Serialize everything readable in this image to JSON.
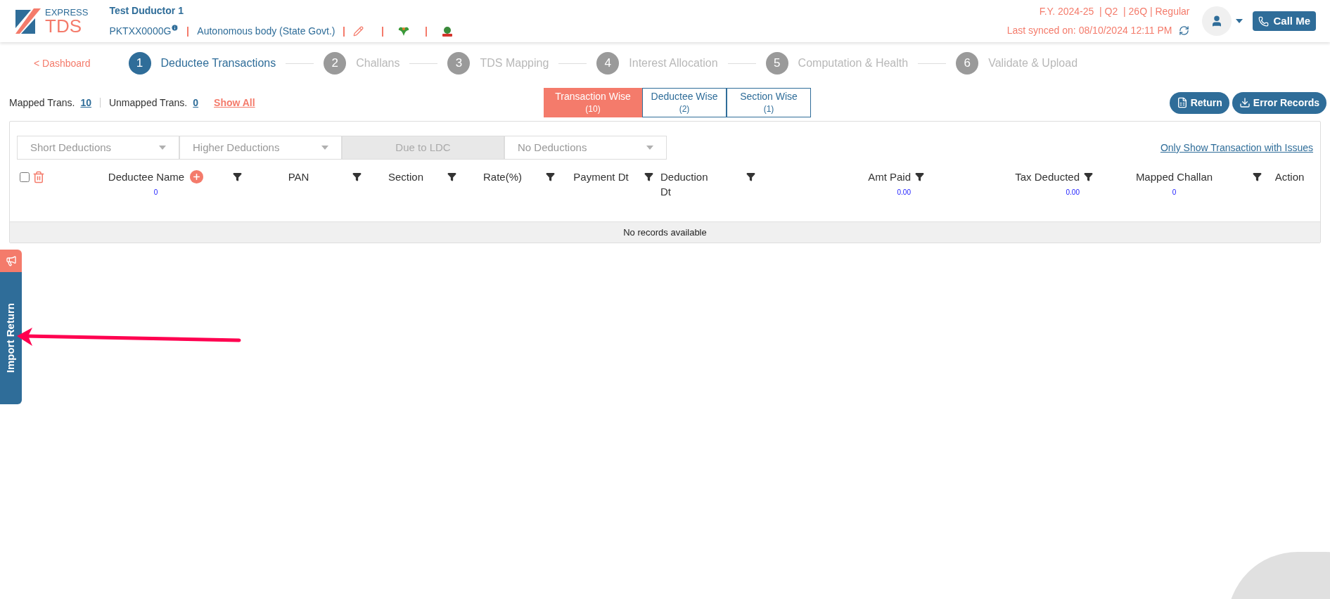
{
  "header": {
    "logo": {
      "top": "EXPRESS",
      "bottom": "TDS"
    },
    "deductor_name": "Test Duductor 1",
    "pan": "PKTXX0000G",
    "deductor_type": "Autonomous body (State Govt.)",
    "return_info": "F.Y. 2024-25  | Q2  | 26Q | Regular",
    "last_synced": "Last synced on: 08/10/2024 12:11 PM",
    "call_button": "Call Me"
  },
  "back_link": "< Dashboard",
  "steps": [
    {
      "number": "1",
      "label": "Deductee Transactions",
      "selected": true
    },
    {
      "number": "2",
      "label": "Challans",
      "selected": false
    },
    {
      "number": "3",
      "label": "TDS Mapping",
      "selected": false
    },
    {
      "number": "4",
      "label": "Interest Allocation",
      "selected": false
    },
    {
      "number": "5",
      "label": "Computation & Health",
      "selected": false
    },
    {
      "number": "6",
      "label": "Validate & Upload",
      "selected": false
    }
  ],
  "summary": {
    "mapped_label": "Mapped Trans.",
    "mapped_count": "10",
    "unmapped_label": "Unmapped Trans.",
    "unmapped_count": "0",
    "show_all": "Show All"
  },
  "view_tabs": [
    {
      "label": "Transaction Wise",
      "count": "(10)",
      "selected": true
    },
    {
      "label": "Deductee Wise",
      "count": "(2)",
      "selected": false
    },
    {
      "label": "Section Wise",
      "count": "(1)",
      "selected": false
    }
  ],
  "actions": [
    "Return",
    "Error Records"
  ],
  "filters": [
    {
      "label": "Short Deductions",
      "disabled": false
    },
    {
      "label": "Higher Deductions",
      "disabled": false
    },
    {
      "label": "Due to LDC",
      "disabled": true
    },
    {
      "label": "No Deductions",
      "disabled": false
    }
  ],
  "issues_link": "Only Show Transaction with Issues",
  "table": {
    "select_all": {
      "checked": false
    },
    "columns": [
      {
        "label": "Deductee Name",
        "count": "0",
        "filter": true,
        "add_button": true
      },
      {
        "label": "PAN",
        "filter": true,
        "add_button": false
      },
      {
        "label": "Section",
        "filter": true,
        "add_button": false
      },
      {
        "label": "Rate(%)",
        "filter": true,
        "add_button": false
      },
      {
        "label": "Payment Dt",
        "filter": true,
        "add_button": false
      },
      {
        "label": "Deduction Dt",
        "filter": true,
        "add_button": false
      },
      {
        "label": "Amt Paid",
        "count": "0.00",
        "filter": true,
        "add_button": false
      },
      {
        "label": "Tax Deducted",
        "count": "0.00",
        "filter": true,
        "add_button": false
      },
      {
        "label": "Mapped Challan",
        "count": "0",
        "filter": true,
        "add_button": false
      },
      {
        "label": "Action",
        "filter": false,
        "add_button": false
      }
    ],
    "empty_message": "No records available"
  },
  "side_tab": "Import Return"
}
